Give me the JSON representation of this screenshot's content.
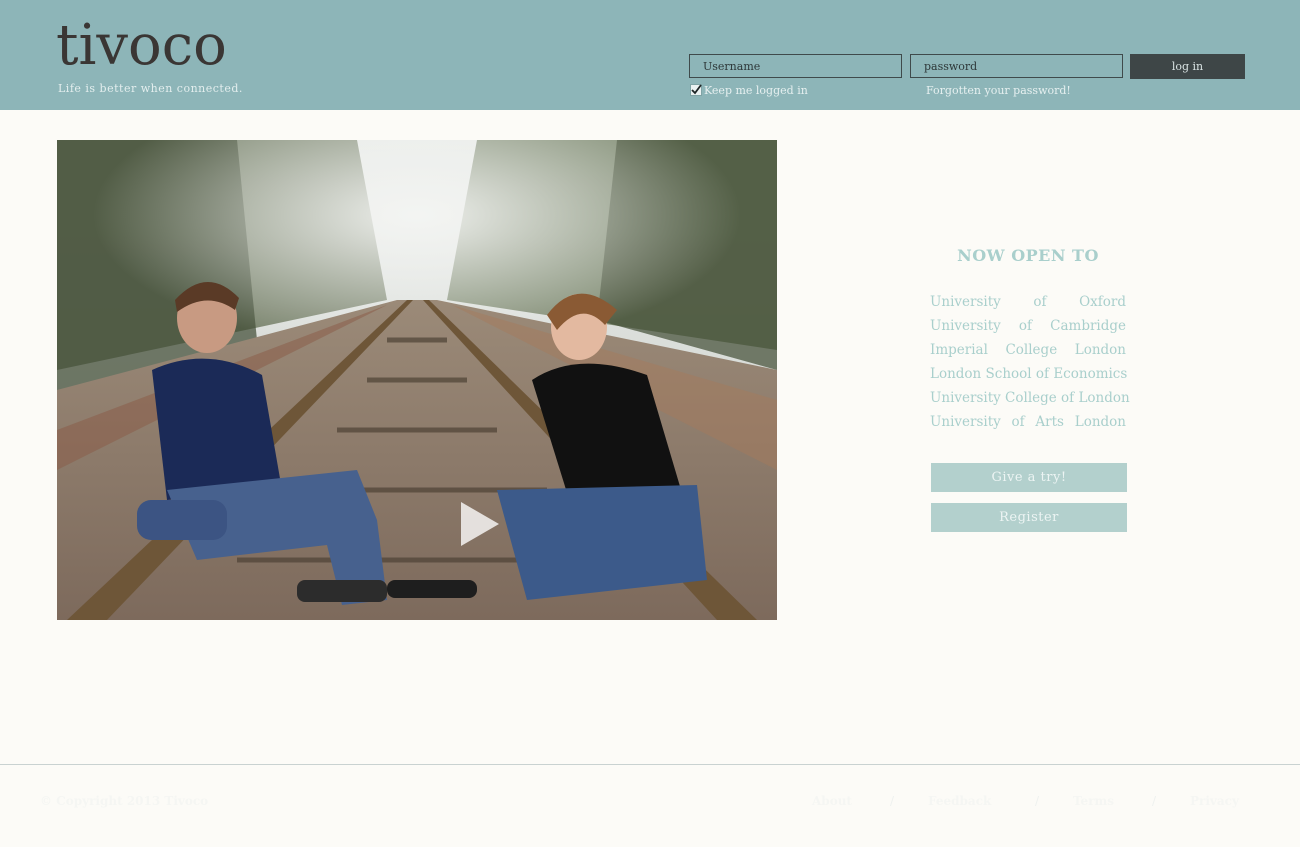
{
  "header": {
    "logo": "tivoco",
    "tagline": "Life is better when connected.",
    "username_placeholder": "Username",
    "password_placeholder": "password",
    "login_label": "log in",
    "keep_logged_in": "Keep me logged in",
    "forgot_password": "Forgotten your password!"
  },
  "video": {
    "play_icon": "play-icon"
  },
  "panel": {
    "title": "NOW OPEN TO",
    "universities": [
      "University of Oxford",
      "University of Cambridge",
      "Imperial College London",
      "London School of Economics",
      "University College of London",
      "University of Arts London"
    ],
    "give_try": "Give a try!",
    "register": "Register"
  },
  "footer": {
    "copyright": "© Copyright 2013 Tivoco",
    "links": [
      "About",
      "Feedback",
      "Terms",
      "Privacy"
    ],
    "separator": "/"
  },
  "colors": {
    "header_bg": "#8db5b8",
    "accent": "#a9cfcc",
    "button_dark": "#3e4647"
  }
}
